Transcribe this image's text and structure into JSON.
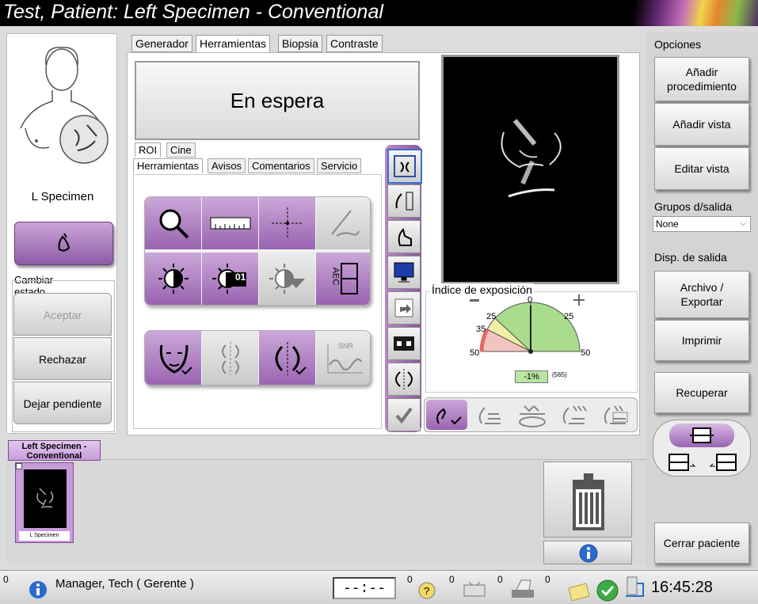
{
  "window": {
    "title": "Test, Patient:  Left Specimen - Conventional"
  },
  "left_panel": {
    "view_label": "L Specimen",
    "change_state_label": "Cambiar estado",
    "accept_label": "Aceptar",
    "reject_label": "Rechazar",
    "pending_label": "Dejar pendiente"
  },
  "tabs": [
    "Generador",
    "Herramientas",
    "Biopsia",
    "Contraste"
  ],
  "selected_tab": "Herramientas",
  "status_display": "En espera",
  "sub_tabs_top": [
    "ROI",
    "Cine"
  ],
  "sub_tabs": [
    "Herramientas",
    "Avisos",
    "Comentarios",
    "Servicio"
  ],
  "tools": {
    "row1": [
      "magnifier-icon",
      "ruler-icon",
      "crosshair-icon",
      "needle-icon"
    ],
    "row2": [
      "contrast-icon",
      "contrast-preset-icon",
      "contrast-adjust-icon",
      "aec-icon"
    ],
    "row3": [
      "face-check-icon",
      "view-split-icon",
      "view-flip-icon",
      "snr-icon"
    ],
    "preset_number": "01",
    "aec_label": "AEC",
    "snr_label": "SNR"
  },
  "exposure": {
    "title": "Índice de exposición",
    "scale_labels": [
      "25",
      "0",
      "25",
      "35",
      "50",
      "50"
    ],
    "value": "-1%",
    "secondary": "(565)"
  },
  "right_panel": {
    "options_label": "Opciones",
    "add_procedure": "Añadir procedimiento",
    "add_view": "Añadir vista",
    "edit_view": "Editar vista",
    "output_groups_label": "Grupos d/salida",
    "output_groups_value": "None",
    "output_devices_label": "Disp. de salida",
    "archive_export": "Archivo / Exportar",
    "print": "Imprimir",
    "retrieve": "Recuperar",
    "close_patient": "Cerrar paciente"
  },
  "thumbnails": {
    "group_tab": "Left Specimen - Conventional",
    "item_label": "L Specimen"
  },
  "statusbar": {
    "left_count": "0",
    "user": "Manager, Tech ( Gerente )",
    "timer": "--:--",
    "count1": "0",
    "count2": "0",
    "count3": "0",
    "count4": "0",
    "clock": "16:45:28"
  },
  "colors": {
    "accent_purple": "#9963b0",
    "title_bg": "#000000",
    "exposure_green": "#a9dc8c",
    "exposure_red": "#e26a63"
  }
}
